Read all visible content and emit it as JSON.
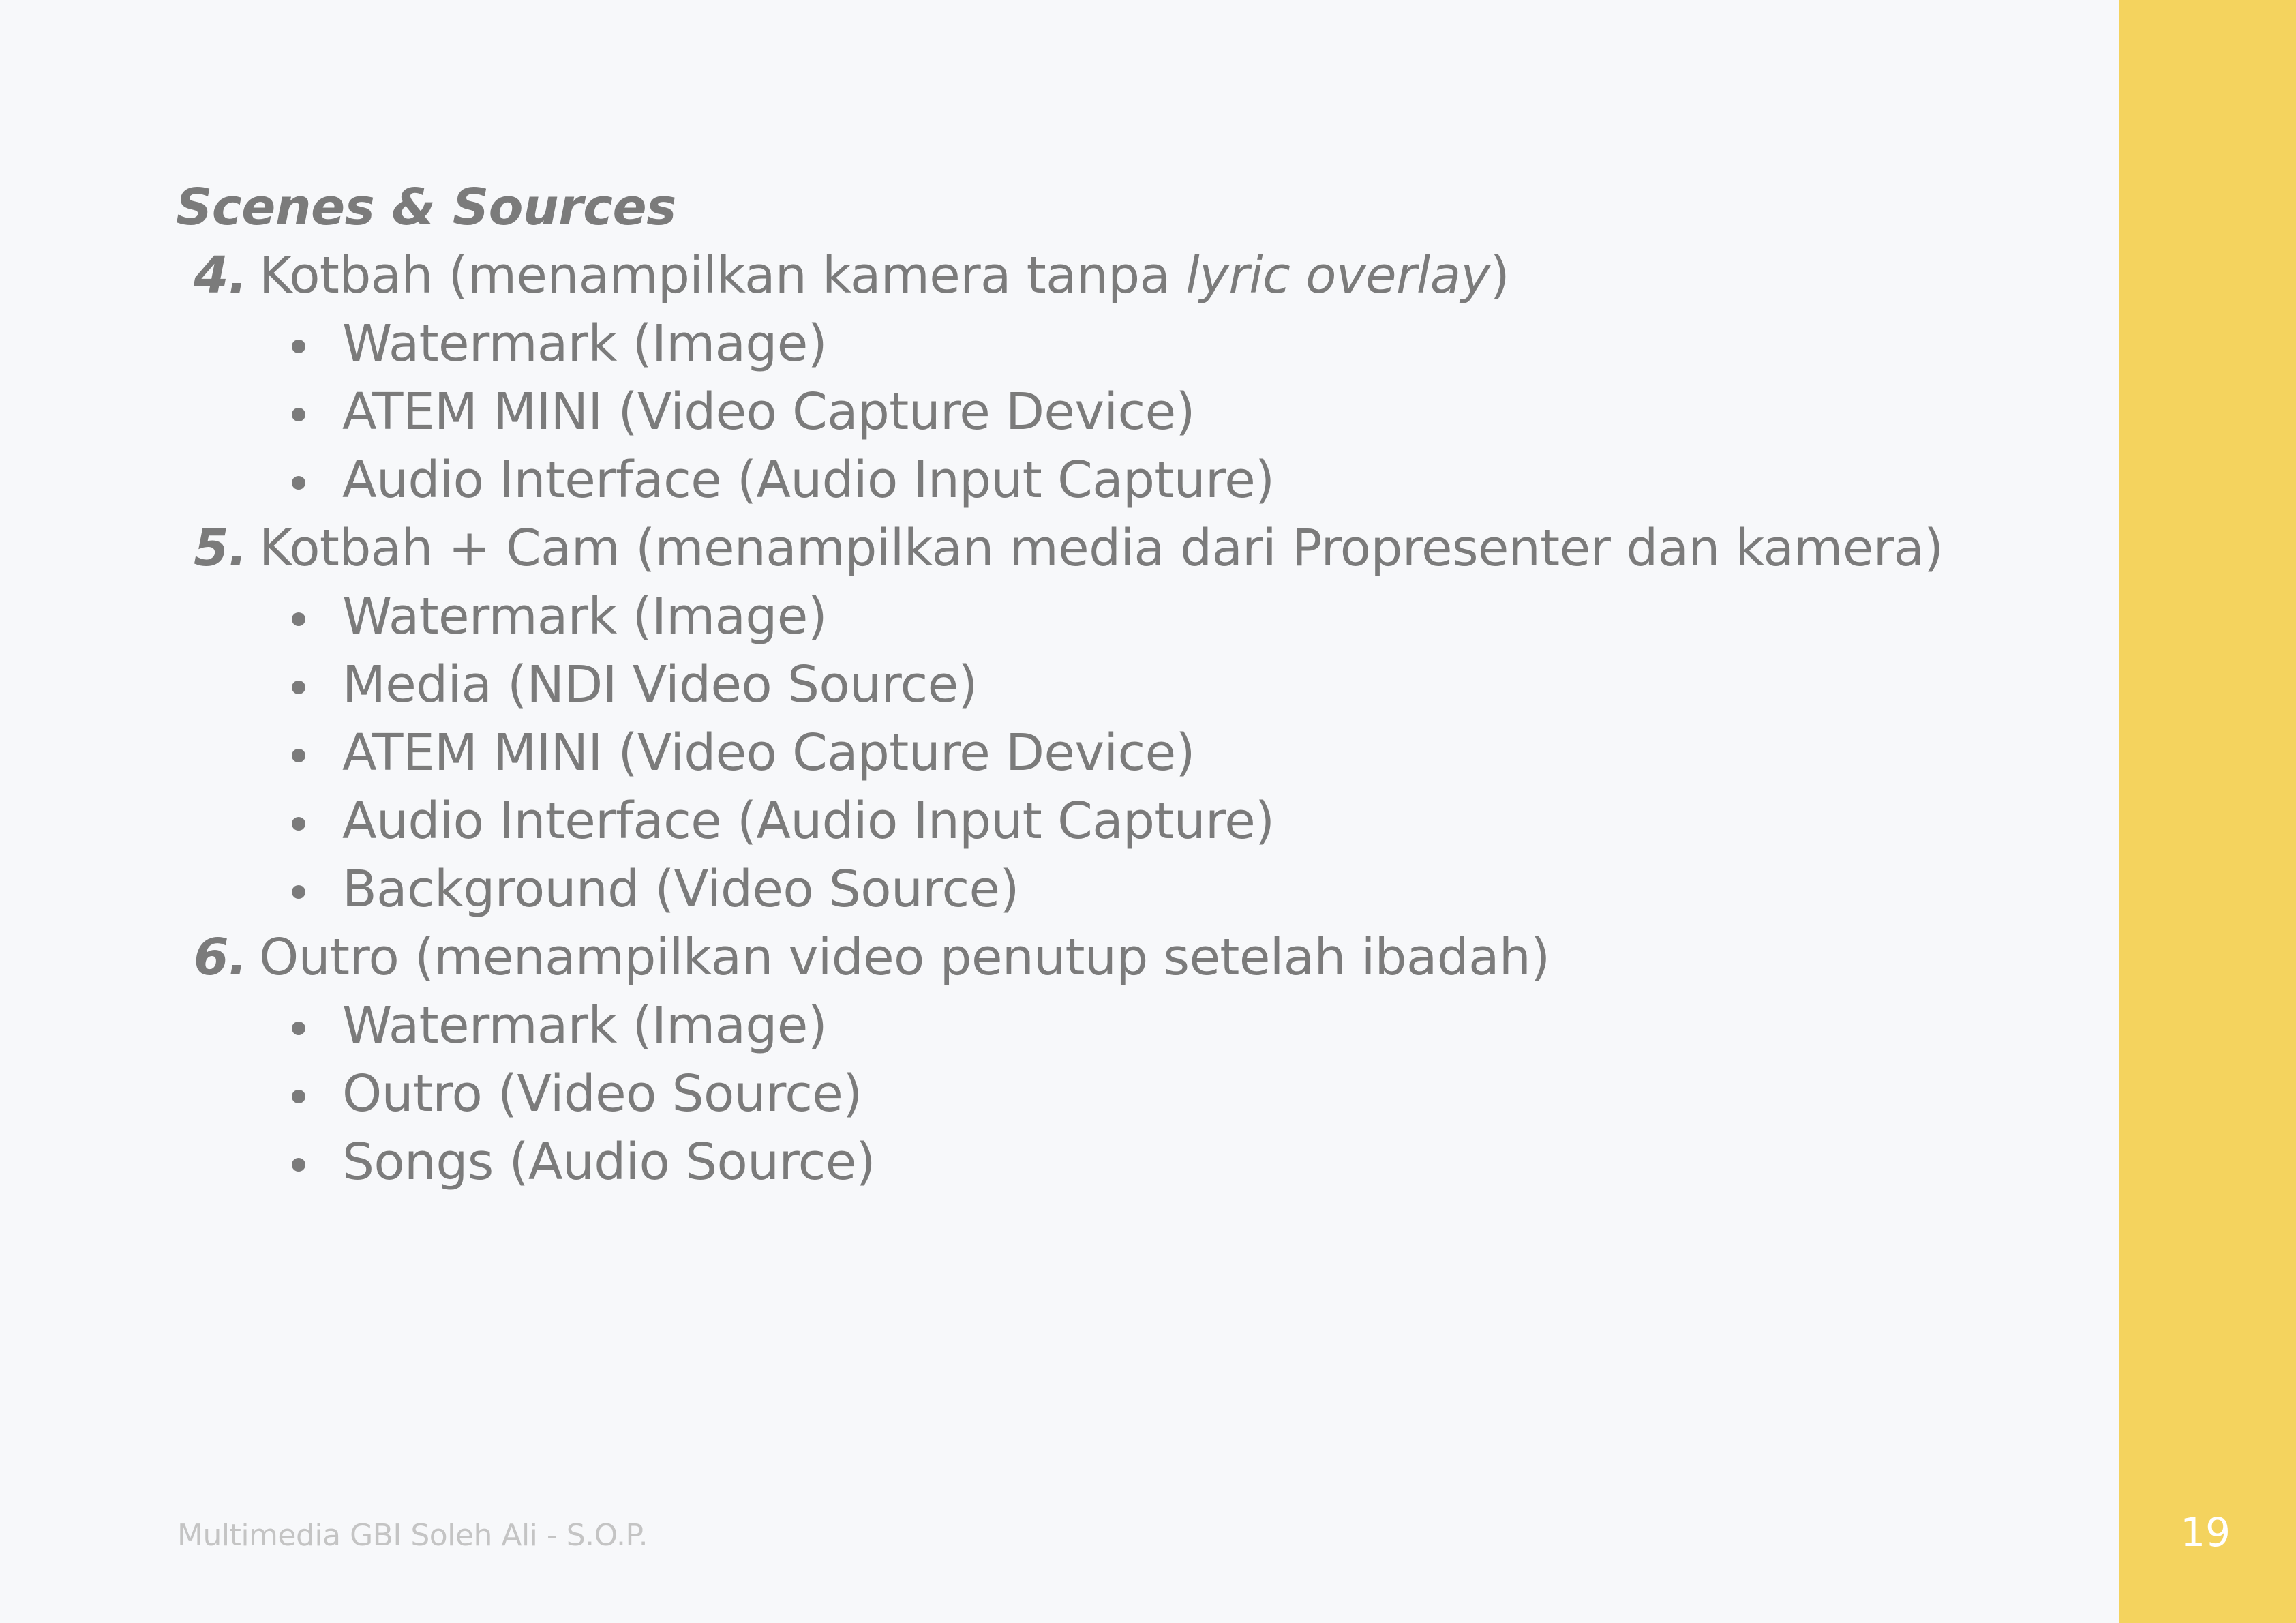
{
  "slide": {
    "heading": "Scenes & Sources",
    "footer": "Multimedia GBI Soleh Ali - S.O.P.",
    "page_number": "19",
    "accent_color": "#f4d35e",
    "text_color": "#7b7b7b",
    "background_color": "#f7f8fa"
  },
  "scenes": [
    {
      "number": "4.",
      "title_prefix": "Kotbah (menampilkan kamera tanpa ",
      "title_emphasis": "lyric overlay",
      "title_suffix": ")",
      "sources": [
        "Watermark (Image)",
        "ATEM MINI (Video Capture Device)",
        "Audio Interface (Audio Input Capture)"
      ]
    },
    {
      "number": "5.",
      "title_prefix": "Kotbah + Cam (menampilkan media dari Propresenter dan kamera)",
      "title_emphasis": "",
      "title_suffix": "",
      "sources": [
        "Watermark (Image)",
        "Media (NDI Video Source)",
        "ATEM MINI (Video Capture Device)",
        "Audio Interface (Audio Input Capture)",
        "Background (Video Source)"
      ]
    },
    {
      "number": "6.",
      "title_prefix": "Outro (menampilkan video penutup setelah ibadah)",
      "title_emphasis": "",
      "title_suffix": "",
      "sources": [
        "Watermark (Image)",
        "Outro (Video Source)",
        "Songs (Audio Source)"
      ]
    }
  ]
}
